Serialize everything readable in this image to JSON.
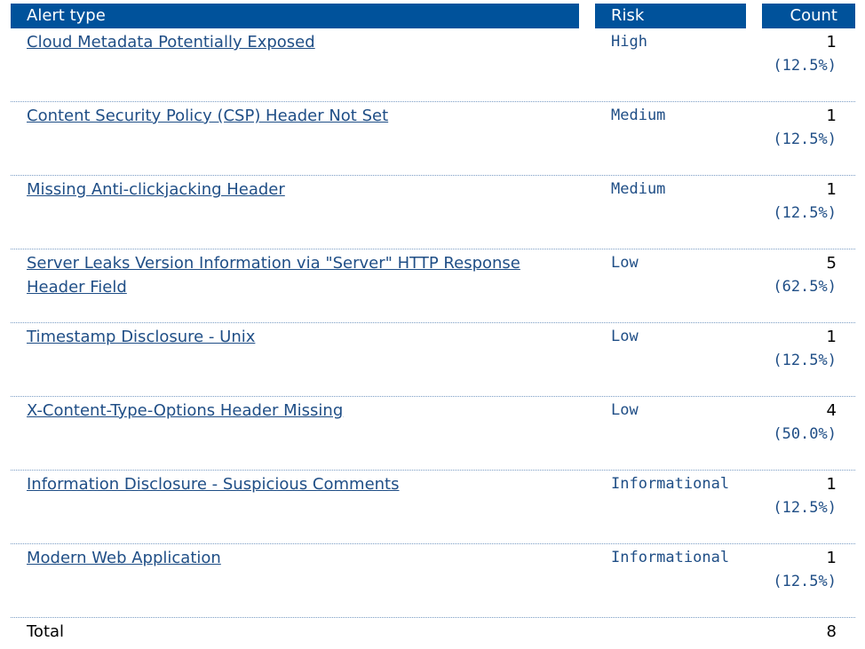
{
  "table": {
    "headers": {
      "alert_type": "Alert type",
      "risk": "Risk",
      "count": "Count"
    },
    "rows": [
      {
        "alert": "Cloud Metadata Potentially Exposed",
        "risk": "High",
        "count": "1",
        "percent": "(12.5%)"
      },
      {
        "alert": "Content Security Policy (CSP) Header Not Set",
        "risk": "Medium",
        "count": "1",
        "percent": "(12.5%)"
      },
      {
        "alert": "Missing Anti-clickjacking Header",
        "risk": "Medium",
        "count": "1",
        "percent": "(12.5%)"
      },
      {
        "alert": "Server Leaks Version Information via \"Server\" HTTP Response Header Field",
        "risk": "Low",
        "count": "5",
        "percent": "(62.5%)"
      },
      {
        "alert": "Timestamp Disclosure - Unix",
        "risk": "Low",
        "count": "1",
        "percent": "(12.5%)"
      },
      {
        "alert": "X-Content-Type-Options Header Missing",
        "risk": "Low",
        "count": "4",
        "percent": "(50.0%)"
      },
      {
        "alert": "Information Disclosure - Suspicious Comments",
        "risk": "Informational",
        "count": "1",
        "percent": "(12.5%)"
      },
      {
        "alert": "Modern Web Application",
        "risk": "Informational",
        "count": "1",
        "percent": "(12.5%)"
      }
    ],
    "total": {
      "label": "Total",
      "count": "8"
    }
  },
  "colors": {
    "header_bg": "#00529b",
    "link": "#1f4e86"
  }
}
